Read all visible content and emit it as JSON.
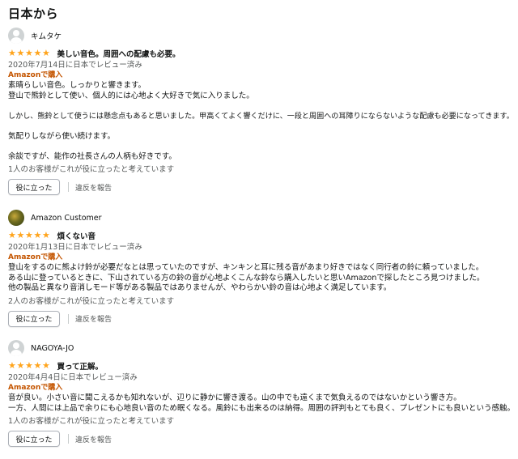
{
  "section": {
    "heading": "日本から"
  },
  "colors": {
    "star": "#ffa41c",
    "verified": "#c45500",
    "muted": "#565959"
  },
  "reviews": [
    {
      "author": "キムタケ",
      "avatar": "default-avatar",
      "rating": 5,
      "title": "美しい音色。周囲への配慮も必要。",
      "date": "2020年7月14日に日本でレビュー済み",
      "verified": "Amazonで購入",
      "body": [
        "素晴らしい音色。しっかりと響きます。",
        "登山で熊鈴として使い、個人的には心地よく大好きで気に入りました。",
        "",
        "しかし、熊鈴として使うには懸念点もあると思いました。甲高くてよく響くだけに、一段と周囲への耳障りにならないような配慮も必要になってきます。",
        "",
        "気配りしながら使い続けます。",
        "",
        "余談ですが、能作の社長さんの人柄も好きです。"
      ],
      "helpful": "1人のお客様がこれが役に立ったと考えています",
      "helpful_button": "役に立った",
      "report": "違反を報告"
    },
    {
      "author": "Amazon Customer",
      "avatar": "photo-avatar",
      "rating": 5,
      "title": "煩くない音",
      "date": "2020年1月13日に日本でレビュー済み",
      "verified": "Amazonで購入",
      "body": [
        "登山をするのに熊よけ鈴が必要だなとは思っていたのですが、キンキンと耳に残る音があまり好きではなく同行者の鈴に頼っていました。",
        "ある山に登っているときに、下山されている方の鈴の音が心地よくこんな鈴なら購入したいと思いAmazonで探したところ見つけました。",
        "他の製品と異なり音消しモード等がある製品ではありませんが、やわらかい鈴の音は心地よく満足しています。"
      ],
      "helpful": "2人のお客様がこれが役に立ったと考えています",
      "helpful_button": "役に立った",
      "report": "違反を報告"
    },
    {
      "author": "NAGOYA-JO",
      "avatar": "default-avatar",
      "rating": 5,
      "title": "買って正解。",
      "date": "2020年4月4日に日本でレビュー済み",
      "verified": "Amazonで購入",
      "body": [
        "音が良い。小さい音に聞こえるかも知れないが、辺りに静かに響き渡る。山の中でも遠くまで気負えるのではないかという響き方。",
        "一方、人間には上品で余りにも心地良い音のため眠くなる。風鈴にも出来るのは納得。周囲の評判もとても良く、プレゼントにも良いという感触。"
      ],
      "helpful": "1人のお客様がこれが役に立ったと考えています",
      "helpful_button": "役に立った",
      "report": "違反を報告"
    }
  ]
}
